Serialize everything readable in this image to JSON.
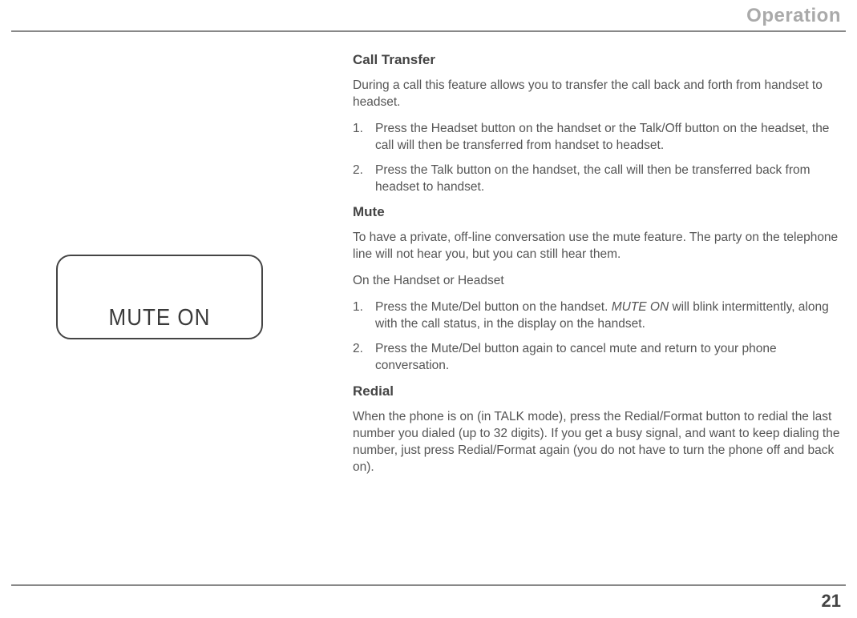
{
  "header": {
    "title": "Operation"
  },
  "footer": {
    "page_number": "21"
  },
  "display": {
    "text": "MUTE ON"
  },
  "sections": {
    "call_transfer": {
      "title": "Call Transfer",
      "intro": "During a call this feature allows you to transfer the call back and forth from handset to headset.",
      "steps": [
        "Press the Headset button on the handset or the Talk/Off button on the headset, the call will then be transferred from handset to headset.",
        "Press the Talk button on the handset, the call will then be transferred back from headset to handset."
      ]
    },
    "mute": {
      "title": "Mute",
      "intro": "To have a private, off-line conversation use the mute feature. The party on the telephone line will not hear you, but you can still hear them.",
      "subhead": "On the Handset or Headset",
      "step1_prefix": "Press the Mute/Del button on the handset. ",
      "step1_italic": "MUTE ON",
      "step1_suffix": " will blink intermittently, along with the call status, in the display on the handset.",
      "step2": "Press the Mute/Del button again to cancel mute and return to your phone conversation."
    },
    "redial": {
      "title": "Redial",
      "body": "When the phone is on (in TALK mode), press the Redial/Format button to redial the last number you dialed (up to 32 digits). If you get a busy signal, and want to keep dialing the number, just press Redial/Format again (you do not have to turn the phone off and back on)."
    }
  }
}
